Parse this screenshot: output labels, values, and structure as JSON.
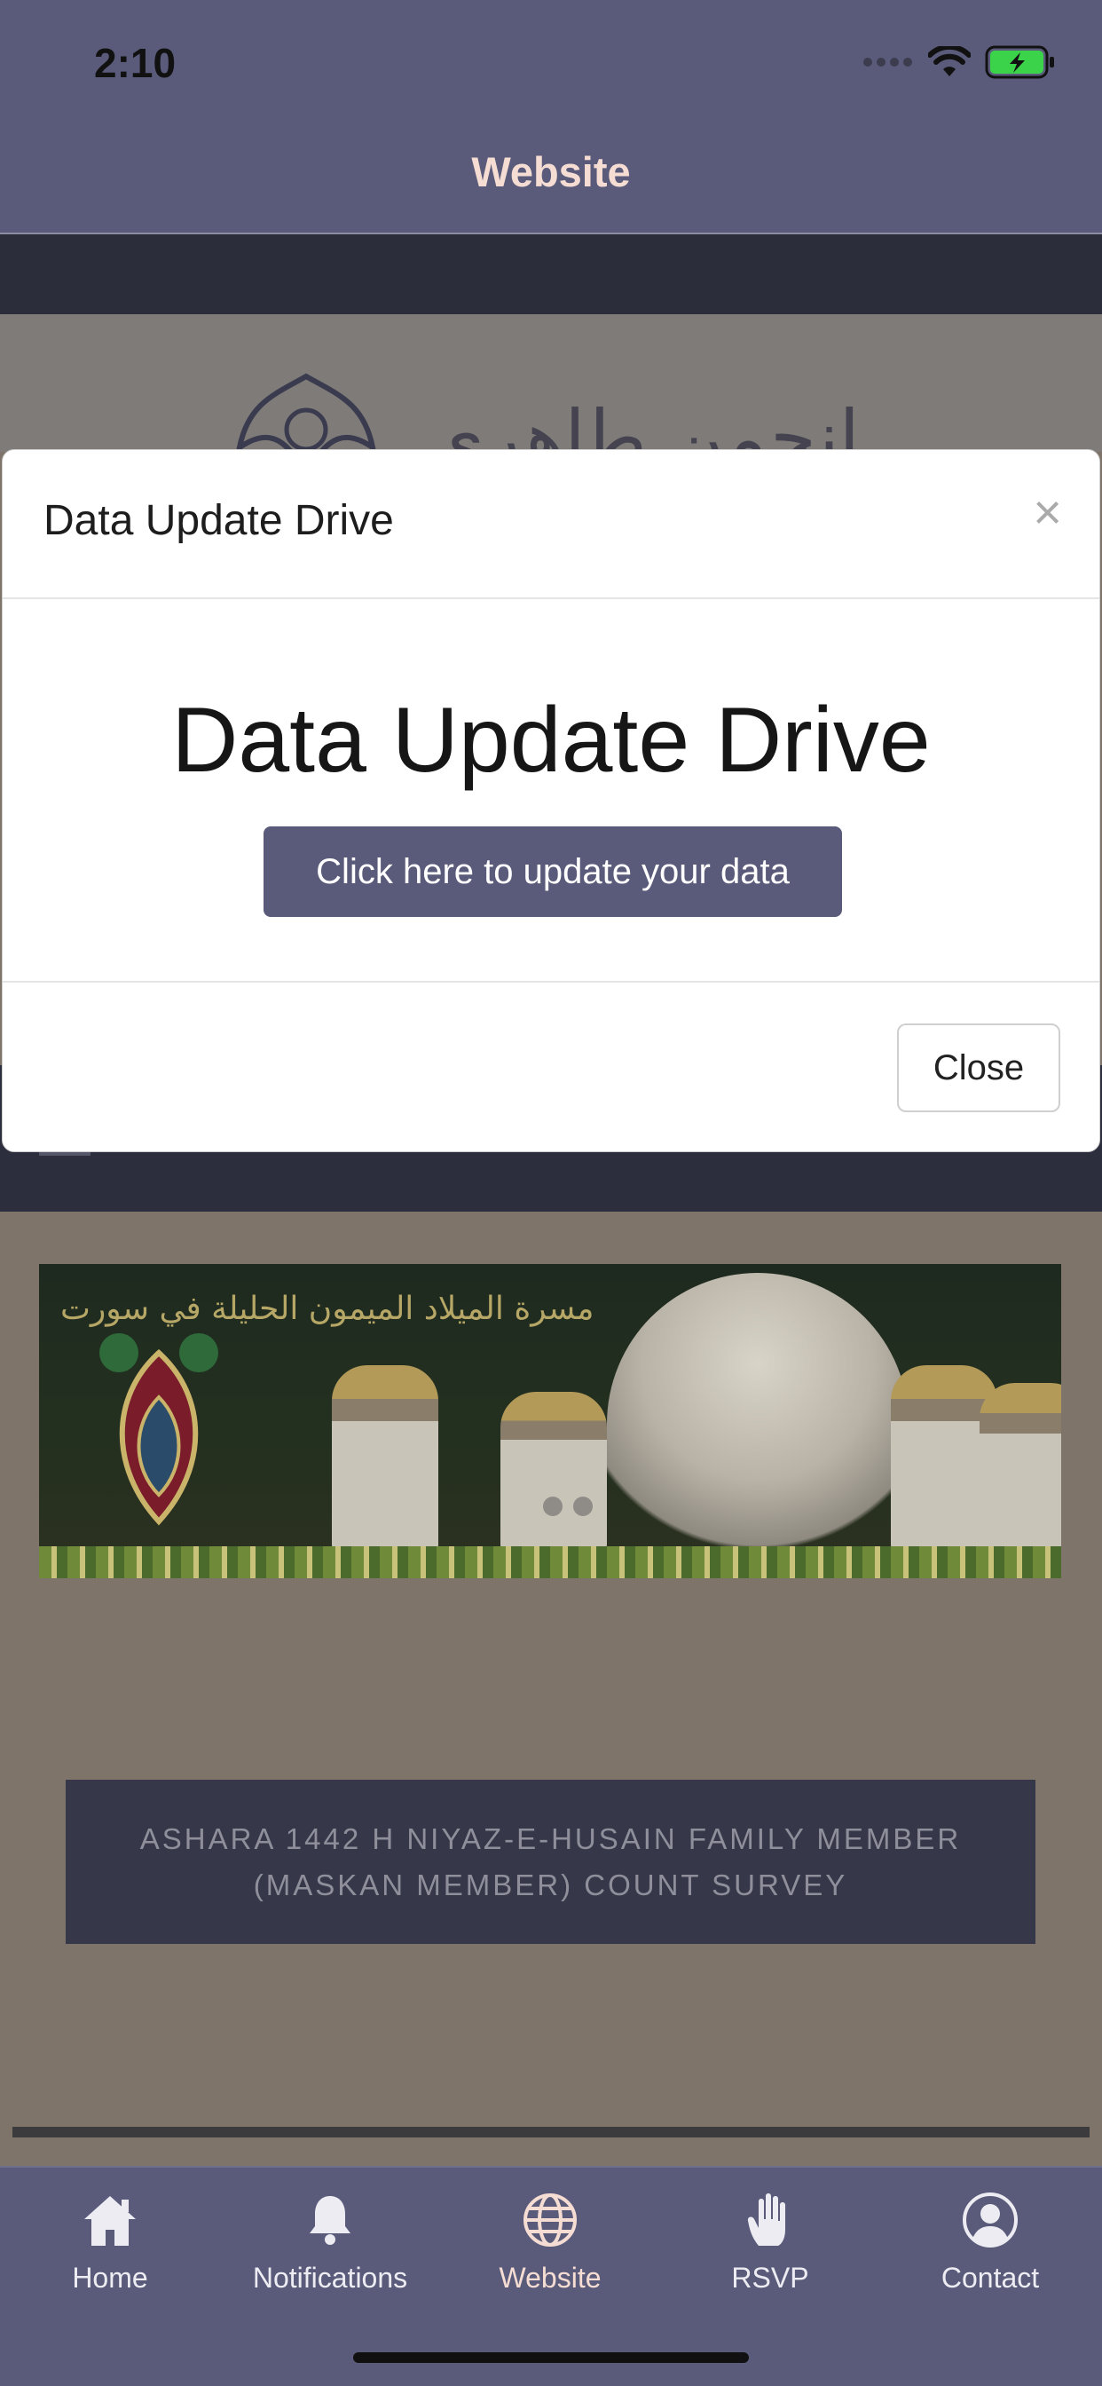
{
  "status_bar": {
    "time": "2:10"
  },
  "nav": {
    "title": "Website"
  },
  "modal": {
    "title": "Data Update Drive",
    "close_symbol": "×",
    "heading": "Data Update Drive",
    "update_button": "Click here to update your data",
    "close_button": "Close"
  },
  "page": {
    "logo_text": "انجمن طاهری",
    "banner_text": "مسرة الميلاد الميمون الحليلة في سورت",
    "survey_button": "ASHARA 1442 H NIYAZ-E-HUSAIN FAMILY MEMBER (MASKAN MEMBER) COUNT SURVEY"
  },
  "tabbar": {
    "items": [
      {
        "label": "Home",
        "icon": "home-icon"
      },
      {
        "label": "Notifications",
        "icon": "bell-icon"
      },
      {
        "label": "Website",
        "icon": "globe-icon",
        "active": true
      },
      {
        "label": "RSVP",
        "icon": "hand-icon"
      },
      {
        "label": "Contact",
        "icon": "user-circle-icon"
      }
    ]
  },
  "colors": {
    "header": "#5a5b7a",
    "title_text": "#f6ddd3",
    "primary_button": "#5a5b7a",
    "survey_button": "#363748"
  }
}
